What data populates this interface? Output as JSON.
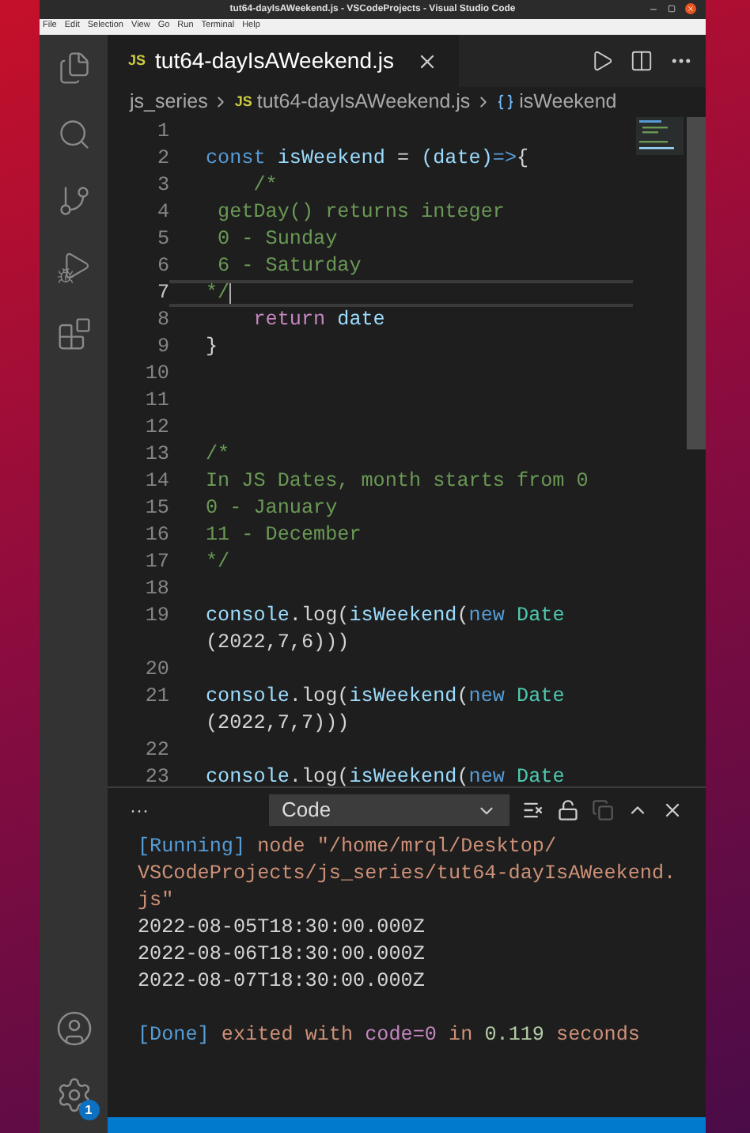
{
  "window": {
    "title": "tut64-dayIsAWeekend.js - VSCodeProjects - Visual Studio Code"
  },
  "menu": [
    "File",
    "Edit",
    "Selection",
    "View",
    "Go",
    "Run",
    "Terminal",
    "Help"
  ],
  "activity_bar": {
    "badge": "1"
  },
  "tabs": [
    {
      "icon": "JS",
      "label": "tut64-dayIsAWeekend.js",
      "selected": true
    }
  ],
  "breadcrumbs": [
    {
      "label": "js_series"
    },
    {
      "icon": "JS",
      "label": "tut64-dayIsAWeekend.js"
    },
    {
      "label": "isWeekend"
    }
  ],
  "editor": {
    "lines": [
      {
        "number": "1",
        "current": false
      },
      {
        "number": "2",
        "current": false,
        "rows": [
          [
            {
              "text": "const",
              "kind": "keyword"
            },
            {
              "text": " isWeekend ",
              "kind": "variable"
            },
            {
              "text": "= ",
              "kind": "plain"
            },
            {
              "text": "(date)",
              "kind": "variable"
            },
            {
              "text": "=>",
              "kind": "keyword"
            },
            {
              "text": "{",
              "kind": "plain"
            }
          ]
        ]
      },
      {
        "number": "3",
        "current": false,
        "rows": [
          [
            {
              "text": "    /*",
              "kind": "comment"
            }
          ]
        ]
      },
      {
        "number": "4",
        "current": false,
        "rows": [
          [
            {
              "text": " getDay() returns integer",
              "kind": "comment"
            }
          ]
        ]
      },
      {
        "number": "5",
        "current": false,
        "rows": [
          [
            {
              "text": " 0 - Sunday",
              "kind": "comment"
            }
          ]
        ]
      },
      {
        "number": "6",
        "current": false,
        "rows": [
          [
            {
              "text": " 6 - Saturday",
              "kind": "comment"
            }
          ]
        ]
      },
      {
        "number": "7",
        "current": true,
        "rows": [
          [
            {
              "text": "*/",
              "kind": "comment"
            }
          ]
        ]
      },
      {
        "number": "8",
        "current": false,
        "rows": [
          [
            {
              "text": "    return",
              "kind": "control"
            },
            {
              "text": " date",
              "kind": "variable"
            }
          ]
        ]
      },
      {
        "number": "9",
        "current": false,
        "rows": [
          [
            {
              "text": "}",
              "kind": "plain"
            }
          ]
        ]
      },
      {
        "number": "10",
        "current": false
      },
      {
        "number": "11",
        "current": false
      },
      {
        "number": "12",
        "current": false
      },
      {
        "number": "13",
        "current": false,
        "rows": [
          [
            {
              "text": "/*",
              "kind": "comment"
            }
          ]
        ]
      },
      {
        "number": "14",
        "current": false,
        "rows": [
          [
            {
              "text": "In JS Dates, month starts from 0",
              "kind": "comment"
            }
          ]
        ]
      },
      {
        "number": "15",
        "current": false,
        "rows": [
          [
            {
              "text": "0 - January",
              "kind": "comment"
            }
          ]
        ]
      },
      {
        "number": "16",
        "current": false,
        "rows": [
          [
            {
              "text": "11 - December",
              "kind": "comment"
            }
          ]
        ]
      },
      {
        "number": "17",
        "current": false,
        "rows": [
          [
            {
              "text": "*/",
              "kind": "comment"
            }
          ]
        ]
      },
      {
        "number": "18",
        "current": false
      },
      {
        "number": "19",
        "current": false,
        "rows": [
          [
            {
              "text": "console",
              "kind": "variable"
            },
            {
              "text": ".log(",
              "kind": "plain"
            },
            {
              "text": "isWeekend",
              "kind": "variable"
            },
            {
              "text": "(",
              "kind": "plain"
            },
            {
              "text": "new",
              "kind": "keyword"
            },
            {
              "text": " Date",
              "kind": "class"
            }
          ],
          [
            {
              "text": "(2022,7,6)))",
              "kind": "plain"
            }
          ]
        ]
      },
      {
        "number": "20",
        "current": false
      },
      {
        "number": "21",
        "current": false,
        "rows": [
          [
            {
              "text": "console",
              "kind": "variable"
            },
            {
              "text": ".log(",
              "kind": "plain"
            },
            {
              "text": "isWeekend",
              "kind": "variable"
            },
            {
              "text": "(",
              "kind": "plain"
            },
            {
              "text": "new",
              "kind": "keyword"
            },
            {
              "text": " Date",
              "kind": "class"
            }
          ],
          [
            {
              "text": "(2022,7,7)))",
              "kind": "plain"
            }
          ]
        ]
      },
      {
        "number": "22",
        "current": false
      },
      {
        "number": "23",
        "current": false,
        "rows": [
          [
            {
              "text": "console",
              "kind": "variable"
            },
            {
              "text": ".log(",
              "kind": "plain"
            },
            {
              "text": "isWeekend",
              "kind": "variable"
            },
            {
              "text": "(",
              "kind": "plain"
            },
            {
              "text": "new",
              "kind": "keyword"
            },
            {
              "text": " Date",
              "kind": "class"
            }
          ]
        ]
      }
    ]
  },
  "panel": {
    "more": "···",
    "dropdown": {
      "value": "Code"
    },
    "output": [
      {
        "kind": "text",
        "rows": [
          [
            {
              "text": "[Running]",
              "kind": "tag"
            },
            {
              "text": " node \"/home/mrql/Desktop/",
              "kind": "string"
            }
          ],
          [
            {
              "text": "VSCodeProjects/js_series/tut64-dayIsAWeekend.",
              "kind": "string"
            }
          ],
          [
            {
              "text": "js\"",
              "kind": "string"
            }
          ]
        ]
      },
      {
        "kind": "text",
        "rows": [
          [
            {
              "text": "2022-08-05T18:30:00.000Z",
              "kind": "plain"
            }
          ]
        ]
      },
      {
        "kind": "text",
        "rows": [
          [
            {
              "text": "2022-08-06T18:30:00.000Z",
              "kind": "plain"
            }
          ]
        ]
      },
      {
        "kind": "text",
        "rows": [
          [
            {
              "text": "2022-08-07T18:30:00.000Z",
              "kind": "plain"
            }
          ]
        ]
      },
      {
        "kind": "blank"
      },
      {
        "kind": "text",
        "rows": [
          [
            {
              "text": "[Done]",
              "kind": "tag"
            },
            {
              "text": " exited with ",
              "kind": "string"
            },
            {
              "text": "code=0",
              "kind": "keyword"
            },
            {
              "text": " in ",
              "kind": "string"
            },
            {
              "text": "0.119",
              "kind": "number"
            },
            {
              "text": " seconds",
              "kind": "string"
            }
          ]
        ]
      }
    ]
  }
}
